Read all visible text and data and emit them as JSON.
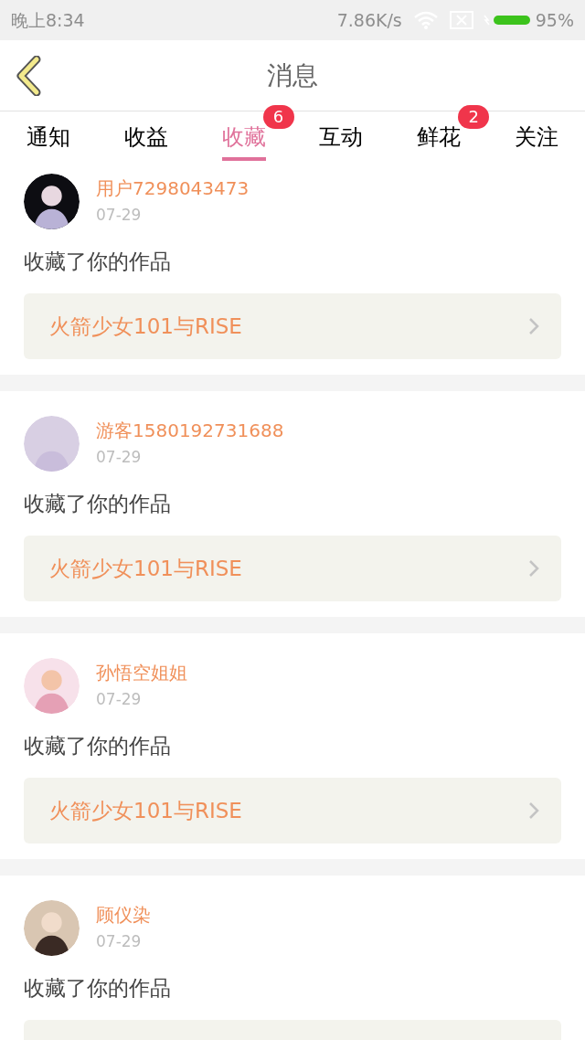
{
  "status_bar": {
    "time": "晚上8:34",
    "speed": "7.86K/s",
    "battery": "95%"
  },
  "header": {
    "title": "消息"
  },
  "tabs": [
    {
      "label": "通知",
      "selected": false
    },
    {
      "label": "收益",
      "selected": false
    },
    {
      "label": "收藏",
      "selected": true,
      "badge": "6"
    },
    {
      "label": "互动",
      "selected": false
    },
    {
      "label": "鲜花",
      "selected": false,
      "badge": "2"
    },
    {
      "label": "关注",
      "selected": false
    }
  ],
  "messages": [
    {
      "user": "用户7298043473",
      "date": "07-29",
      "action": "收藏了你的作品",
      "work": "火箭少女101与RISE"
    },
    {
      "user": "游客1580192731688",
      "date": "07-29",
      "action": "收藏了你的作品",
      "work": "火箭少女101与RISE"
    },
    {
      "user": "孙悟空姐姐",
      "date": "07-29",
      "action": "收藏了你的作品",
      "work": "火箭少女101与RISE"
    },
    {
      "user": "顾仪染",
      "date": "07-29",
      "action": "收藏了你的作品"
    }
  ]
}
